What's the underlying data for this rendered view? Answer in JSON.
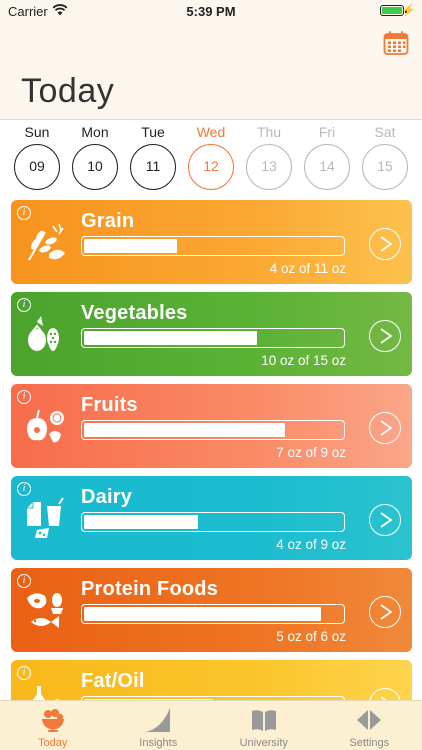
{
  "status_bar": {
    "carrier": "Carrier",
    "time": "5:39 PM"
  },
  "header": {
    "title": "Today",
    "calendar_icon": "calendar-icon"
  },
  "week": [
    {
      "name": "Sun",
      "date": "09",
      "state": "past"
    },
    {
      "name": "Mon",
      "date": "10",
      "state": "past"
    },
    {
      "name": "Tue",
      "date": "11",
      "state": "past"
    },
    {
      "name": "Wed",
      "date": "12",
      "state": "active"
    },
    {
      "name": "Thu",
      "date": "13",
      "state": "future"
    },
    {
      "name": "Fri",
      "date": "14",
      "state": "future"
    },
    {
      "name": "Sat",
      "date": "15",
      "state": "future"
    }
  ],
  "food_groups": [
    {
      "name": "Grain",
      "amount": "4 oz of 11 oz",
      "progress": 0.36,
      "icon": "grain-icon"
    },
    {
      "name": "Vegetables",
      "amount": "10 oz of 15 oz",
      "progress": 0.67,
      "icon": "vegetables-icon"
    },
    {
      "name": "Fruits",
      "amount": "7 oz of 9 oz",
      "progress": 0.78,
      "icon": "fruits-icon"
    },
    {
      "name": "Dairy",
      "amount": "4 oz of 9 oz",
      "progress": 0.44,
      "icon": "dairy-icon"
    },
    {
      "name": "Protein Foods",
      "amount": "5 oz of 6 oz",
      "progress": 0.92,
      "icon": "protein-icon"
    },
    {
      "name": "Fat/Oil",
      "amount": "",
      "progress": 0.5,
      "icon": "fat-oil-icon"
    }
  ],
  "tabs": [
    {
      "label": "Today",
      "active": true,
      "icon": "bowl-icon"
    },
    {
      "label": "Insights",
      "active": false,
      "icon": "insights-icon"
    },
    {
      "label": "University",
      "active": false,
      "icon": "book-icon"
    },
    {
      "label": "Settings",
      "active": false,
      "icon": "settings-icon"
    }
  ],
  "colors": {
    "accent": "#f07a3a",
    "grain": "#f7931e",
    "vegetables": "#4ba32d",
    "fruits": "#f86c4a",
    "dairy": "#1ab9cf",
    "protein": "#ea6014",
    "fat_oil": "#f8b81a"
  }
}
